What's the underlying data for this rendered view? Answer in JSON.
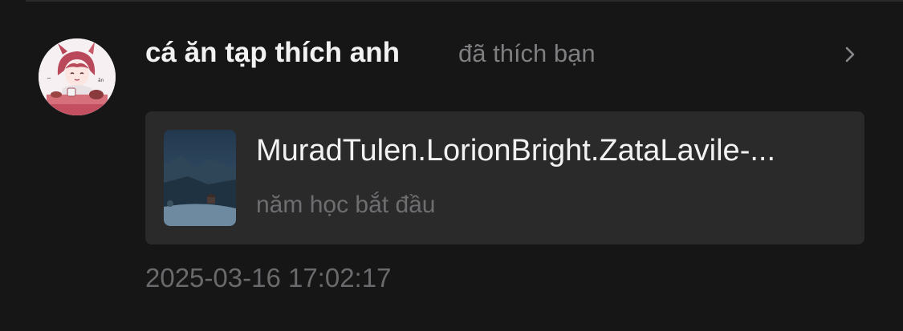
{
  "notification": {
    "user_name": "cá ăn tạp thích anh",
    "action_text": "đã thích bạn",
    "avatar_icon": "anime-character-avatar",
    "chevron_icon": "chevron-right-icon",
    "card": {
      "title": "MuradTulen.LorionBright.ZataLavile-...",
      "subtitle": "năm học bắt đầu",
      "thumbnail": "night-landscape-thumbnail"
    },
    "timestamp": "2025-03-16 17:02:17"
  },
  "colors": {
    "background": "#161617",
    "card_background": "#2a2a2b",
    "primary_text": "#f2f2f2",
    "secondary_text": "#7f7f82"
  }
}
